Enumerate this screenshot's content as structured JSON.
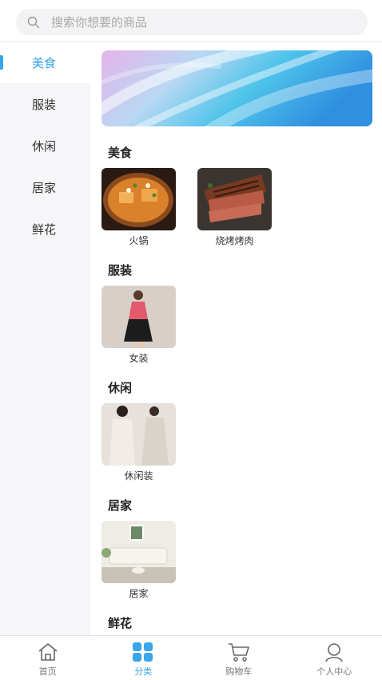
{
  "search": {
    "placeholder": "搜索你想要的商品"
  },
  "sidebar": {
    "items": [
      {
        "label": "美食",
        "active": true
      },
      {
        "label": "服装",
        "active": false
      },
      {
        "label": "休闲",
        "active": false
      },
      {
        "label": "居家",
        "active": false
      },
      {
        "label": "鲜花",
        "active": false
      }
    ]
  },
  "sections": [
    {
      "title": "美食",
      "products": [
        {
          "label": "火锅"
        },
        {
          "label": "烧烤烤肉"
        }
      ]
    },
    {
      "title": "服装",
      "products": [
        {
          "label": "女装"
        }
      ]
    },
    {
      "title": "休闲",
      "products": [
        {
          "label": "休闲装"
        }
      ]
    },
    {
      "title": "居家",
      "products": [
        {
          "label": "居家"
        }
      ]
    },
    {
      "title": "鲜花",
      "products": []
    }
  ],
  "tabbar": {
    "items": [
      {
        "label": "首页",
        "icon": "home-icon",
        "active": false
      },
      {
        "label": "分类",
        "icon": "category-icon",
        "active": true
      },
      {
        "label": "购物车",
        "icon": "cart-icon",
        "active": false
      },
      {
        "label": "个人中心",
        "icon": "profile-icon",
        "active": false
      }
    ]
  },
  "colors": {
    "accent": "#3aa5e9",
    "sidebar_bg": "#f6f6f8",
    "search_bg": "#f3f3f5"
  }
}
